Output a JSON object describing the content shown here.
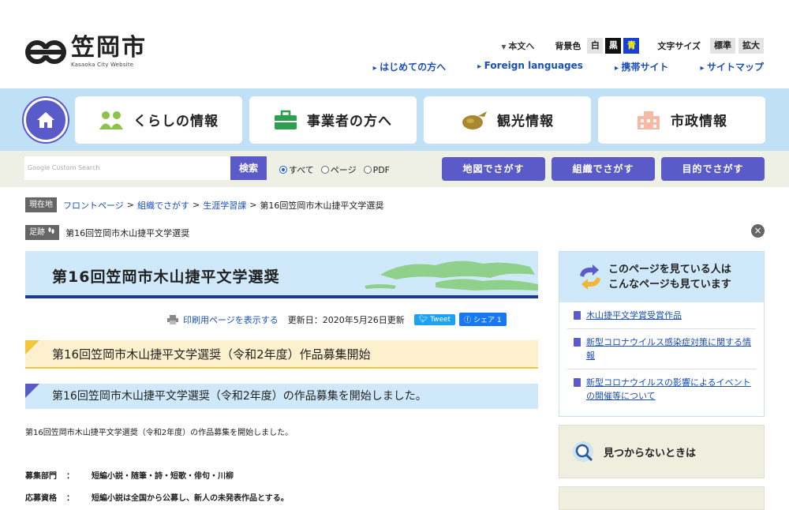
{
  "header": {
    "logo_name": "笠岡市",
    "logo_sub": "Kasaoka City Website",
    "skip": "本文へ",
    "bg_label": "背景色",
    "bg_white": "白",
    "bg_black": "黒",
    "bg_blue": "青",
    "font_label": "文字サイズ",
    "font_std": "標準",
    "font_big": "拡大",
    "links": [
      "はじめての方へ",
      "Foreign languages",
      "携帯サイト",
      "サイトマップ"
    ]
  },
  "gnav": {
    "items": [
      "くらしの情報",
      "事業者の方へ",
      "観光情報",
      "市政情報"
    ]
  },
  "search": {
    "placeholder": "Custom Search",
    "brand": "Google",
    "button": "検索",
    "radios": [
      "すべて",
      "ページ",
      "PDF"
    ],
    "buttons": [
      "地図でさがす",
      "組織でさがす",
      "目的でさがす"
    ]
  },
  "breadcrumb": {
    "tag": "現在地",
    "items": [
      "フロントページ",
      "組織でさがす",
      "生涯学習課"
    ],
    "current": "第16回笠岡市木山捷平文学選奨",
    "sep": ">"
  },
  "trail": {
    "tag": "足跡",
    "item": "第16回笠岡市木山捷平文学選奨"
  },
  "page": {
    "title": "第16回笠岡市木山捷平文学選奨",
    "print": "印刷用ページを表示する",
    "updated": "更新日：2020年5月26日更新",
    "tweet": "Tweet",
    "share": "シェア 1",
    "h2": "第16回笠岡市木山捷平文学選奨（令和2年度）作品募集開始",
    "h3": "第16回笠岡市木山捷平文学選奨（令和2年度）の作品募集を開始しました。",
    "para": "第16回笠岡市木山捷平文学選奨（令和2年度）の作品募集を開始しました。",
    "details": [
      {
        "key": "募集部門",
        "colon": "：",
        "val": "短編小説・随筆・詩・短歌・俳句・川柳"
      },
      {
        "key": "応募資格",
        "colon": "：",
        "val": "短編小説は全国から公募し、新人の未発表作品とする。"
      }
    ]
  },
  "sidebar": {
    "heading1": "このページを見ている人は",
    "heading2": "こんなページも見ています",
    "links": [
      "木山捷平文学賞受賞作品",
      "新型コロナウイルス感染症対策に関する情報",
      "新型コロナウイルスの影響によるイベントの開催等について"
    ],
    "notfound": "見つからないときは"
  },
  "colors": {
    "accent": "#5a5bc8",
    "nav_bg": "#bfe0f5",
    "search_bg": "#eeefe5"
  }
}
